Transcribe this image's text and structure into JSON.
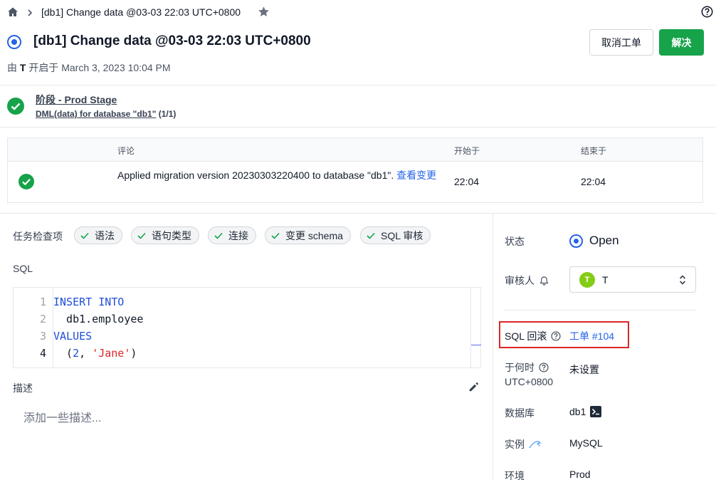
{
  "breadcrumb": {
    "title": "[db1] Change data @03-03 22:03 UTC+0800"
  },
  "header": {
    "title": "[db1] Change data @03-03 22:03 UTC+0800",
    "opened_prefix": "由",
    "opened_user": "T",
    "opened_suffix": "开启于 March 3, 2023 10:04 PM",
    "cancel_label": "取消工单",
    "resolve_label": "解决"
  },
  "stage": {
    "name": "阶段 - Prod Stage",
    "task": "DML(data) for database \"db1\"",
    "task_count": "(1/1)"
  },
  "task_table": {
    "headers": {
      "comment": "评论",
      "started": "开始于",
      "ended": "结束于"
    },
    "row": {
      "comment": "Applied migration version 20230303220400 to database \"db1\".",
      "comment_link": "查看变更",
      "started": "22:04",
      "ended": "22:04"
    }
  },
  "checks": {
    "label": "任务检查项",
    "items": [
      "语法",
      "语句类型",
      "连接",
      "变更 schema",
      "SQL 审核"
    ]
  },
  "sql": {
    "label": "SQL",
    "lines": [
      {
        "no": "1",
        "text": "INSERT INTO"
      },
      {
        "no": "2",
        "text": "  db1.employee"
      },
      {
        "no": "3",
        "text": "VALUES"
      },
      {
        "no": "4",
        "text": "  (2, 'Jane')"
      }
    ]
  },
  "description": {
    "label": "描述",
    "placeholder": "添加一些描述..."
  },
  "sidebar": {
    "status_label": "状态",
    "status_value": "Open",
    "reviewer_label": "审核人",
    "reviewer_initial": "T",
    "reviewer_name": "T",
    "rollback_label": "SQL 回滚",
    "rollback_link": "工单 #104",
    "when_label": "于何时",
    "when_tz": "UTC+0800",
    "when_value": "未设置",
    "database_label": "数据库",
    "database_value": "db1",
    "instance_label": "实例",
    "instance_value": "MySQL",
    "env_label": "环境",
    "env_value": "Prod"
  },
  "colors": {
    "accent": "#2563eb",
    "success": "#16a34a",
    "highlight": "#dc2626"
  }
}
